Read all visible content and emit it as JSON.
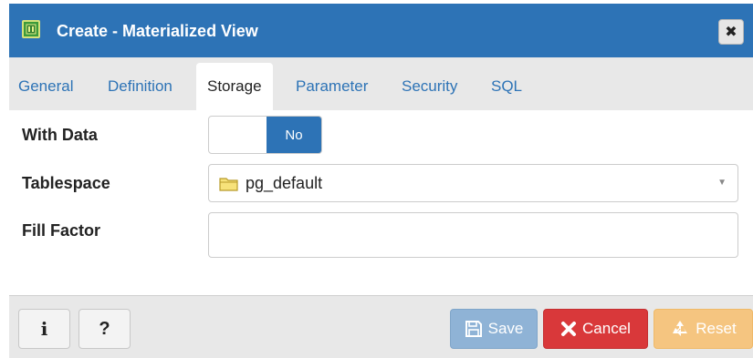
{
  "dialog": {
    "title": "Create - Materialized View",
    "close_symbol": "✖",
    "title_icon": "materialized-view-icon",
    "title_bar_color": "#2d73b6"
  },
  "tabs": [
    {
      "label": "General",
      "active": false
    },
    {
      "label": "Definition",
      "active": false
    },
    {
      "label": "Storage",
      "active": true
    },
    {
      "label": "Parameter",
      "active": false
    },
    {
      "label": "Security",
      "active": false
    },
    {
      "label": "SQL",
      "active": false
    }
  ],
  "form": {
    "with_data": {
      "label": "With Data",
      "value": "No"
    },
    "tablespace": {
      "label": "Tablespace",
      "value": "pg_default",
      "icon": "folder-icon"
    },
    "fill_factor": {
      "label": "Fill Factor",
      "value": ""
    }
  },
  "footer": {
    "info_label": "i",
    "help_label": "?",
    "save_label": "Save",
    "cancel_label": "Cancel",
    "reset_label": "Reset"
  },
  "colors": {
    "accent": "#2d73b6",
    "save": "#8fb3d6",
    "cancel": "#d9383a",
    "reset": "#f5c580"
  }
}
